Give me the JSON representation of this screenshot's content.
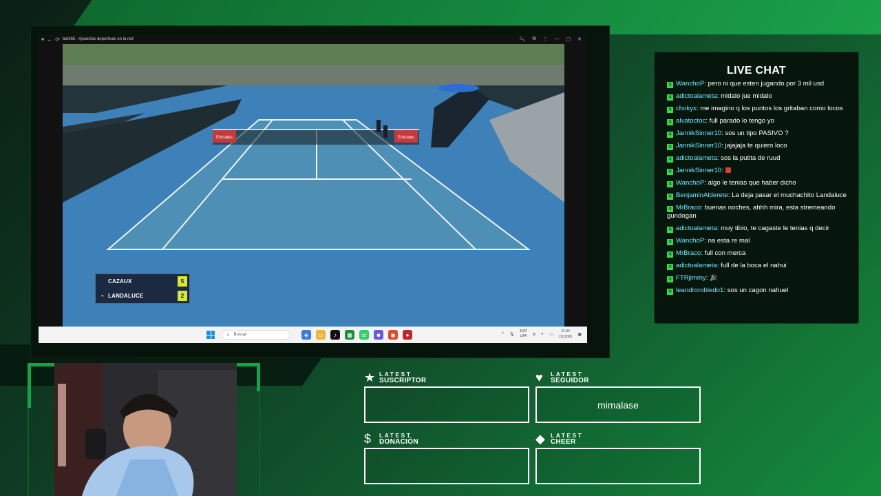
{
  "browser": {
    "title": "bet365 - Apuestas deportivas en la red"
  },
  "scoreboard": {
    "players": [
      {
        "name": "CAZAUX",
        "score": "5",
        "serving": false
      },
      {
        "name": "LANDALUCE",
        "score": "2",
        "serving": true
      }
    ]
  },
  "court_banners": {
    "left": "Emirates",
    "right": "Emirates"
  },
  "taskbar": {
    "search_placeholder": "Buscar",
    "lang_top": "ESP",
    "lang_bottom": "LAA",
    "time": "21:44",
    "date": "2/1/2026"
  },
  "chat": {
    "title": "LIVE CHAT",
    "messages": [
      {
        "user": "WanchoP",
        "text": ": pero ni que esten jugando por 3 mil usd"
      },
      {
        "user": "adictoalameta",
        "text": ": midalo jue midalo"
      },
      {
        "user": "chokyx",
        "text": ": me imagino q los puntos los gritaban como locos"
      },
      {
        "user": "alvatoctoc",
        "text": ": full parado lo tengo yo"
      },
      {
        "user": "JannikSinner10",
        "text": ": sos un tipo PASIVO ?"
      },
      {
        "user": "JannikSinner10",
        "text": ": jajajaja te quiero loco"
      },
      {
        "user": "adictoalameta",
        "text": ": sos la putita de ruud"
      },
      {
        "user": "JannikSinner10",
        "text": ":"
      },
      {
        "user": "WanchoP",
        "text": ": algo le tenias que haber dicho"
      },
      {
        "user": "BenjaminAlderete",
        "text": ": La deja pasar el muchachito Landaluce"
      },
      {
        "user": "MrBraco",
        "text": ": buenas noches, ahhh mira, esta stremeando gundogan"
      },
      {
        "user": "adictoalameta",
        "text": ": muy tibio, te cagaste le tenias q decir"
      },
      {
        "user": "WanchoP",
        "text": ": na esta re mal"
      },
      {
        "user": "MrBraco",
        "text": ": full con merca"
      },
      {
        "user": "adictoalameta",
        "text": ": full de la boca el nahui"
      },
      {
        "user": "FTRjimmy",
        "text": ":"
      },
      {
        "user": "leandrorobledo1",
        "text": ": sos un cagon nahuel"
      }
    ]
  },
  "latest": {
    "suscriptor": {
      "small": "LATEST",
      "big": "SUSCRIPTOR",
      "icon": "star-icon",
      "value": ""
    },
    "seguidor": {
      "small": "LATEST",
      "big": "SEGUIDOR",
      "icon": "heart-icon",
      "value": "mimalase"
    },
    "donacion": {
      "small": "LATEST",
      "big": "DONACIÓN",
      "icon": "dollar-icon",
      "value": ""
    },
    "cheer": {
      "small": "LATEST",
      "big": "CHEER",
      "icon": "diamond-icon",
      "value": ""
    }
  },
  "colors": {
    "accent": "#15a24a",
    "chat_user": "#6ee8ff",
    "score_bg": "#d7e635",
    "court": "#3d7fb7"
  }
}
